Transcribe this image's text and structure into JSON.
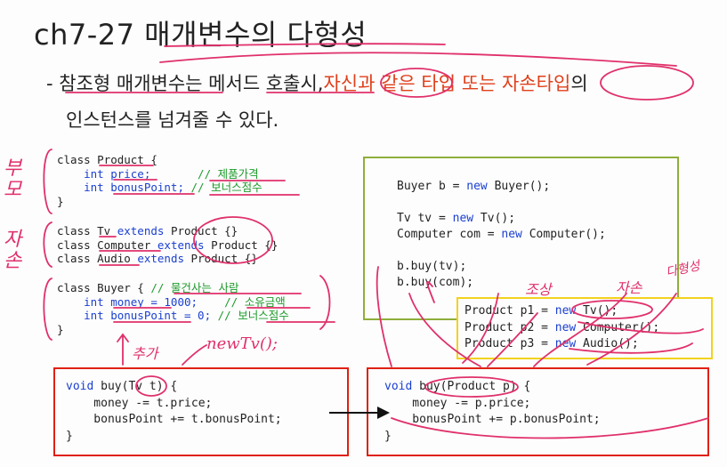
{
  "title": "ch7-27 매개변수의 다형성",
  "bullet": {
    "dash": "-",
    "part1": "참조형 매개변수는 메서드 호출시,",
    "part2": "자신과 같은 타입 또는 자손타입",
    "part3": "의",
    "line2": "인스턴스를 넘겨줄 수 있다."
  },
  "code_left": {
    "product": {
      "line1_a": "class Product {",
      "line2_a": "    int price;       ",
      "line2_c": "// 제품가격",
      "line3_a": "    int bonusPoint; ",
      "line3_c": "// 보너스점수",
      "line4": "}"
    },
    "subclasses": {
      "tv_a": "class Tv ",
      "tv_b": "extends",
      "tv_c": " Product {}",
      "computer_a": "class Computer ",
      "computer_b": "extends",
      "computer_c": " Product {}",
      "audio_a": "class Audio ",
      "audio_b": "extends",
      "audio_c": " Product {}"
    },
    "buyer": {
      "line1_a": "class Buyer { ",
      "line1_c": "// 물건사는 사람",
      "line2_a": "    int money = 1000;    ",
      "line2_c": "// 소유금액",
      "line3_a": "    int bonusPoint = 0; ",
      "line3_c": "// 보너스점수",
      "line4": "}"
    }
  },
  "code_green": {
    "line1_a": "Buyer b = ",
    "line1_b": "new",
    "line1_c": " Buyer();",
    "line2_a": "Tv tv = ",
    "line2_b": "new",
    "line2_c": " Tv();",
    "line3_a": "Computer com = ",
    "line3_b": "new",
    "line3_c": " Computer();",
    "line4": "b.buy(tv);",
    "line5": "b.buy(com);"
  },
  "code_yellow": {
    "line1_a": "Product p1 = ",
    "line1_b": "new",
    "line1_c": " Tv();",
    "line2_a": "Product p2 = ",
    "line2_b": "new",
    "line2_c": " Computer();",
    "line3_a": "Product p3 = ",
    "line3_b": "new",
    "line3_c": " Audio();"
  },
  "code_red_left": {
    "line1_a": "void",
    "line1_b": " buy(Tv t) {",
    "line2": "    money -= t.price;",
    "line3": "    bonusPoint += t.bonusPoint;",
    "line4": "}"
  },
  "code_red_right": {
    "line1_a": "void",
    "line1_b": " buy(Product p) {",
    "line2": "    money -= p.price;",
    "line3": "    bonusPoint += p.bonusPoint;",
    "line4": "}"
  },
  "handwriting": {
    "parent": "부모",
    "child": "자손",
    "added": "추가",
    "new_tv": "newTv();",
    "ancestor": "조상",
    "descendant": "자손",
    "polymorphism": "다형성"
  },
  "colors": {
    "keyword": "#1a3fd0",
    "comment": "#1d9a2b",
    "highlight_text": "#e0401c",
    "ink_pink": "#e0306a",
    "green_box": "#8fae3a",
    "yellow_box": "#f2d21c",
    "red_box": "#e02010"
  }
}
